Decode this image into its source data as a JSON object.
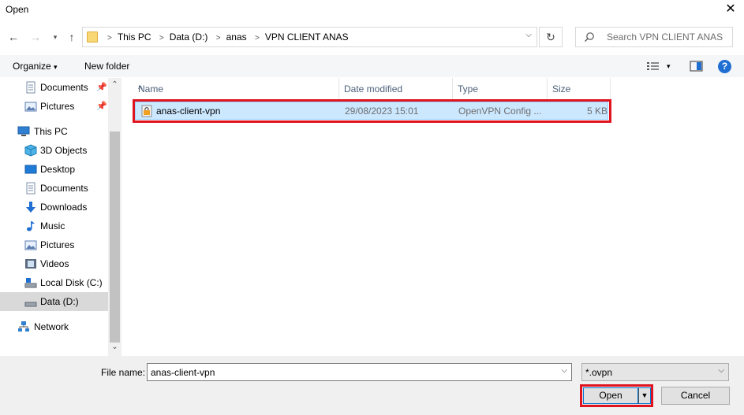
{
  "window": {
    "title": "Open"
  },
  "address": {
    "crumbs": [
      "This PC",
      "Data (D:)",
      "anas",
      "VPN CLIENT ANAS"
    ],
    "search_placeholder": "Search VPN CLIENT ANAS"
  },
  "toolbar": {
    "organize": "Organize",
    "new_folder": "New folder"
  },
  "nav": {
    "items": [
      {
        "label": "Documents",
        "icon": "documents-icon",
        "pinned": true
      },
      {
        "label": "Pictures",
        "icon": "pictures-icon",
        "pinned": true
      },
      {
        "label": "This PC",
        "icon": "this-pc-icon"
      },
      {
        "label": "3D Objects",
        "icon": "3d-objects-icon"
      },
      {
        "label": "Desktop",
        "icon": "desktop-icon"
      },
      {
        "label": "Documents",
        "icon": "documents-icon"
      },
      {
        "label": "Downloads",
        "icon": "downloads-icon"
      },
      {
        "label": "Music",
        "icon": "music-icon"
      },
      {
        "label": "Pictures",
        "icon": "pictures-icon"
      },
      {
        "label": "Videos",
        "icon": "videos-icon"
      },
      {
        "label": "Local Disk (C:)",
        "icon": "local-disk-icon"
      },
      {
        "label": "Data (D:)",
        "icon": "drive-icon",
        "selected": true
      },
      {
        "label": "Network",
        "icon": "network-icon"
      }
    ]
  },
  "list": {
    "columns": {
      "name": "Name",
      "date": "Date modified",
      "type": "Type",
      "size": "Size"
    },
    "rows": [
      {
        "name": "anas-client-vpn",
        "date": "29/08/2023 15:01",
        "type": "OpenVPN Config ...",
        "size": "5 KB",
        "selected": true
      }
    ]
  },
  "footer": {
    "file_name_label": "File name:",
    "file_name_value": "anas-client-vpn",
    "file_type_value": "*.ovpn",
    "open_label": "Open",
    "cancel_label": "Cancel"
  },
  "colors": {
    "highlight": "#e0141e",
    "selection": "#cce8ff",
    "accent": "#0078d7"
  }
}
